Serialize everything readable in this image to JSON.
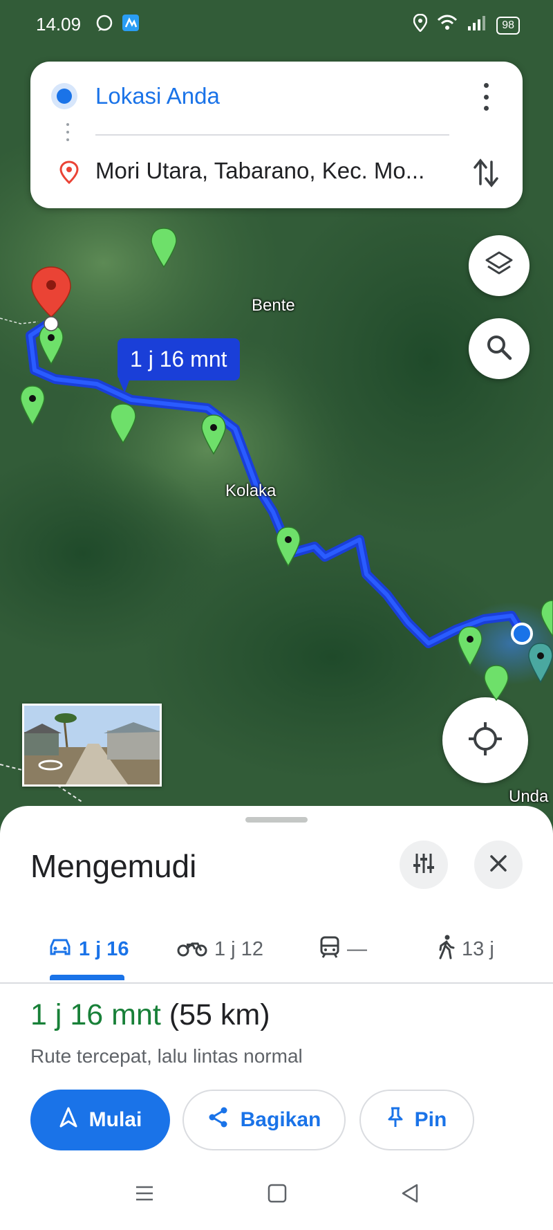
{
  "status_bar": {
    "time": "14.09",
    "battery": "98"
  },
  "search": {
    "origin": "Lokasi Anda",
    "destination": "Mori Utara, Tabarano, Kec. Mo..."
  },
  "map": {
    "place_labels": [
      "Bente",
      "Kolaka",
      "Unda"
    ],
    "route_bubble": "1 j 16 mnt",
    "route_color": "#1a3fd8"
  },
  "sheet": {
    "title": "Mengemudi",
    "tabs": [
      {
        "mode": "car-icon",
        "label": "1 j 16"
      },
      {
        "mode": "motorcycle-icon",
        "label": "1 j 12"
      },
      {
        "mode": "transit-icon",
        "label": "—"
      },
      {
        "mode": "walk-icon",
        "label": "13 j"
      }
    ],
    "duration_time": "1 j 16 mnt",
    "duration_distance": "(55 km)",
    "route_desc": "Rute tercepat, lalu lintas normal",
    "buttons": {
      "start": "Mulai",
      "share": "Bagikan",
      "pin": "Pin"
    }
  },
  "colors": {
    "accent": "#1a73e8",
    "duration_green": "#188038",
    "pin_red": "#ea4335",
    "marker_green": "#6ee06a"
  }
}
